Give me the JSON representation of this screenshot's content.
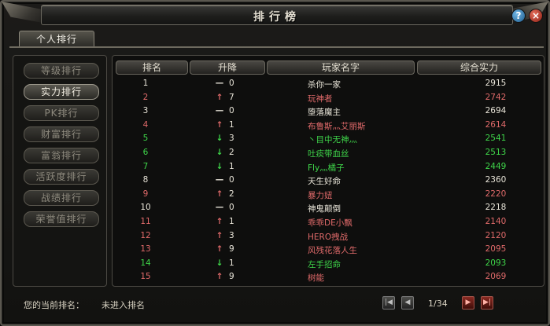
{
  "window": {
    "title": "排行榜"
  },
  "tabs": [
    {
      "label": "个人排行"
    }
  ],
  "categories": [
    {
      "label": "等级排行",
      "active": false
    },
    {
      "label": "实力排行",
      "active": true
    },
    {
      "label": "PK排行",
      "active": false
    },
    {
      "label": "财富排行",
      "active": false
    },
    {
      "label": "富翁排行",
      "active": false
    },
    {
      "label": "活跃度排行",
      "active": false
    },
    {
      "label": "战绩排行",
      "active": false
    },
    {
      "label": "荣誉值排行",
      "active": false
    }
  ],
  "table": {
    "headers": {
      "rank": "排名",
      "change": "升降",
      "name": "玩家名字",
      "power": "综合实力"
    },
    "rows": [
      {
        "rank": "1",
        "arrow": "—",
        "change": "0",
        "name": "杀你一家",
        "power": "2915",
        "trend": "same"
      },
      {
        "rank": "2",
        "arrow": "↑",
        "change": "7",
        "name": "玩神者",
        "power": "2742",
        "trend": "up"
      },
      {
        "rank": "3",
        "arrow": "—",
        "change": "0",
        "name": "堕落魔主",
        "power": "2694",
        "trend": "same"
      },
      {
        "rank": "4",
        "arrow": "↑",
        "change": "1",
        "name": "布鲁斯灬艾丽斯",
        "power": "2614",
        "trend": "up"
      },
      {
        "rank": "5",
        "arrow": "↓",
        "change": "3",
        "name": "丶目中无神灬",
        "power": "2541",
        "trend": "down"
      },
      {
        "rank": "6",
        "arrow": "↓",
        "change": "2",
        "name": "吐痰带血丝",
        "power": "2513",
        "trend": "down"
      },
      {
        "rank": "7",
        "arrow": "↓",
        "change": "1",
        "name": "Fly灬橘子",
        "power": "2449",
        "trend": "down"
      },
      {
        "rank": "8",
        "arrow": "—",
        "change": "0",
        "name": "天生好命",
        "power": "2360",
        "trend": "same"
      },
      {
        "rank": "9",
        "arrow": "↑",
        "change": "2",
        "name": "暴力妞",
        "power": "2220",
        "trend": "up"
      },
      {
        "rank": "10",
        "arrow": "—",
        "change": "0",
        "name": "神鬼颠倒",
        "power": "2218",
        "trend": "same"
      },
      {
        "rank": "11",
        "arrow": "↑",
        "change": "1",
        "name": "乖乖DE小飘",
        "power": "2140",
        "trend": "up"
      },
      {
        "rank": "12",
        "arrow": "↑",
        "change": "3",
        "name": "HERO拽战",
        "power": "2120",
        "trend": "up"
      },
      {
        "rank": "13",
        "arrow": "↑",
        "change": "9",
        "name": "风残花落人生",
        "power": "2095",
        "trend": "up"
      },
      {
        "rank": "14",
        "arrow": "↓",
        "change": "1",
        "name": "左手招命",
        "power": "2093",
        "trend": "down"
      },
      {
        "rank": "15",
        "arrow": "↑",
        "change": "9",
        "name": "树能",
        "power": "2069",
        "trend": "up"
      }
    ]
  },
  "footer": {
    "current_rank_label": "您的当前排名：",
    "current_rank_value": "未进入排名",
    "page": "1/34"
  },
  "icons": {
    "first": "first-page-icon",
    "prev": "prev-page-icon",
    "next": "next-page-icon",
    "last": "last-page-icon",
    "help": "help-icon",
    "close": "close-icon"
  },
  "colors": {
    "up": "#e06a6a",
    "down": "#3fd64a",
    "same": "#e8e4d8"
  }
}
